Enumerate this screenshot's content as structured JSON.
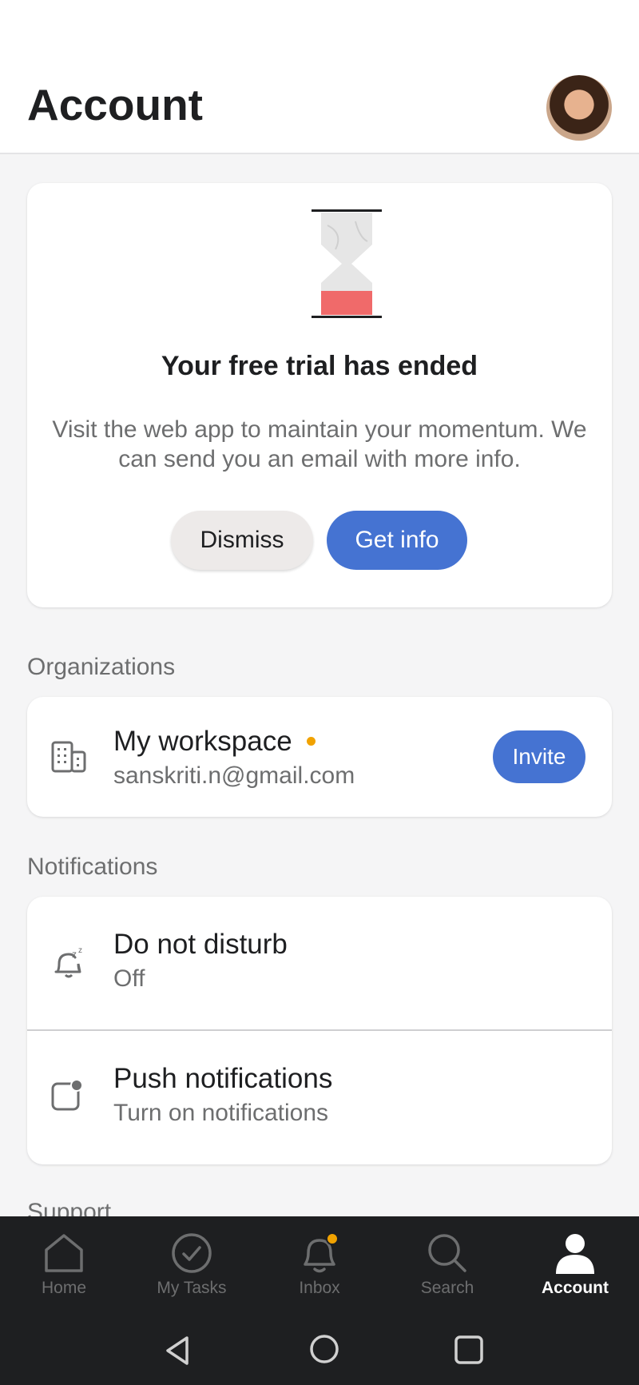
{
  "header": {
    "title": "Account"
  },
  "trial": {
    "title": "Your free trial has ended",
    "message": "Visit the web app to maintain your momentum. We can send you an email with more info.",
    "dismiss_label": "Dismiss",
    "getinfo_label": "Get info"
  },
  "organizations": {
    "section_label": "Organizations",
    "workspace_name": "My workspace",
    "workspace_email": "sanskriti.n@gmail.com",
    "invite_label": "Invite"
  },
  "notifications": {
    "section_label": "Notifications",
    "dnd_title": "Do not disturb",
    "dnd_value": "Off",
    "push_title": "Push notifications",
    "push_value": "Turn on notifications"
  },
  "support": {
    "section_label": "Support"
  },
  "nav": {
    "items": [
      {
        "label": "Home",
        "icon": "home-icon"
      },
      {
        "label": "My Tasks",
        "icon": "check-circle-icon"
      },
      {
        "label": "Inbox",
        "icon": "bell-icon"
      },
      {
        "label": "Search",
        "icon": "search-icon"
      },
      {
        "label": "Account",
        "icon": "person-icon"
      }
    ],
    "active": "Account"
  },
  "colors": {
    "accent": "#4573d2",
    "badge": "#f1a200",
    "nav_bg": "#1e1f21"
  }
}
